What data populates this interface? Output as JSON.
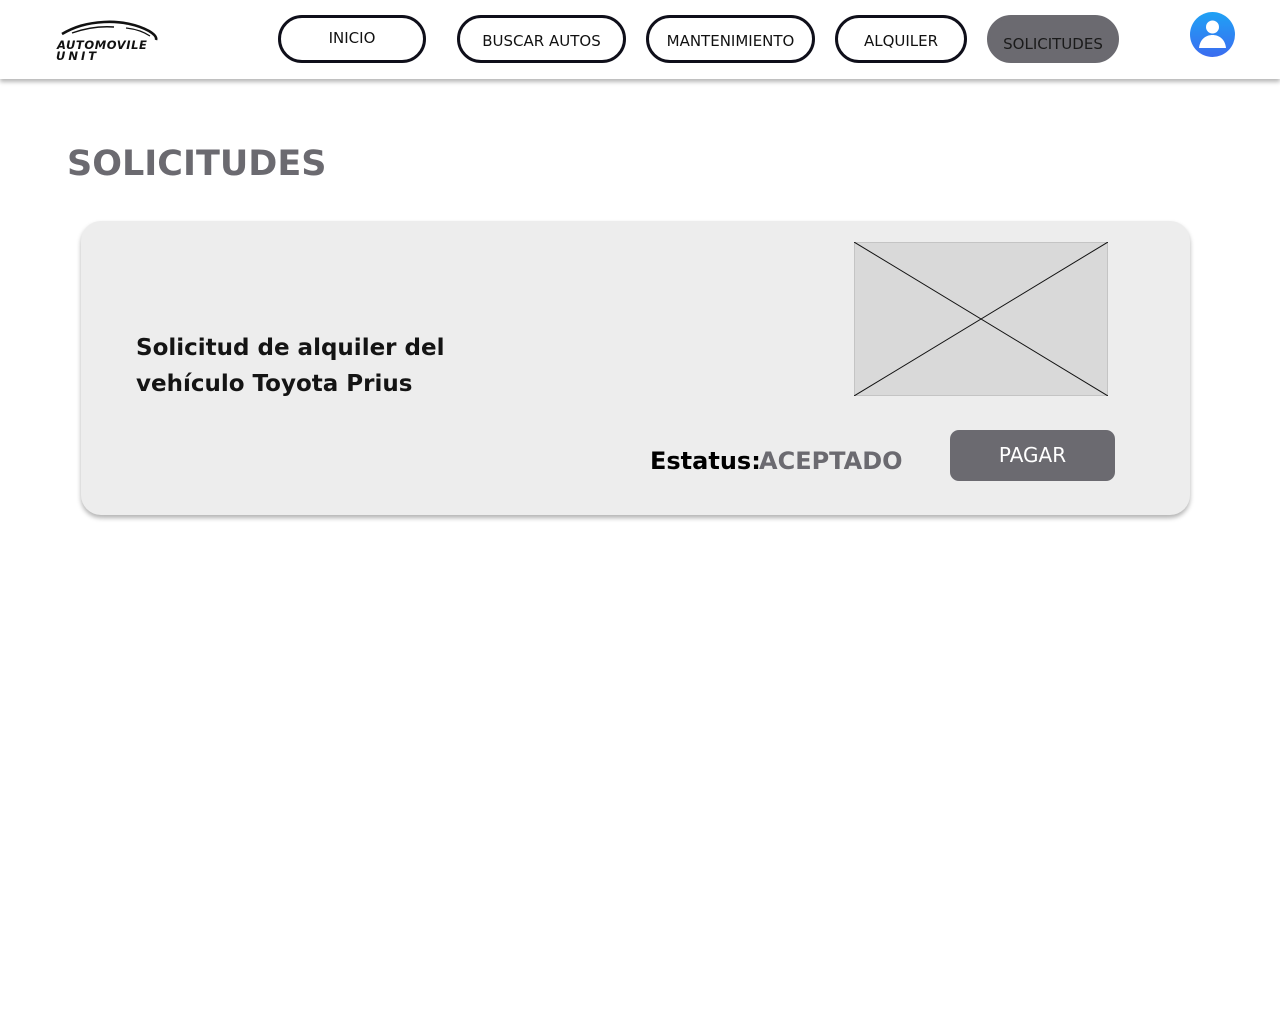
{
  "header": {
    "logo": {
      "line1": "AUTOMOVILE",
      "line2": "UNIT"
    },
    "nav": [
      {
        "label": "INICIO"
      },
      {
        "label": "BUSCAR AUTOS"
      },
      {
        "label": "MANTENIMIENTO"
      },
      {
        "label": "ALQUILER"
      },
      {
        "label": "SOLICITUDES",
        "active": true
      }
    ],
    "avatar_icon": "user-icon"
  },
  "main": {
    "title": "SOLICITUDES",
    "request": {
      "text": "Solicitud de alquiler del vehículo Toyota Prius",
      "image_icon": "image-placeholder",
      "status_label": "Estatus:",
      "status_value": "ACEPTADO",
      "pay_label": "PAGAR"
    }
  },
  "colors": {
    "accent_gray": "#6b6a70",
    "card_bg": "#ededed",
    "avatar_gradient": [
      "#1fa2f5",
      "#3b6cf0"
    ]
  }
}
